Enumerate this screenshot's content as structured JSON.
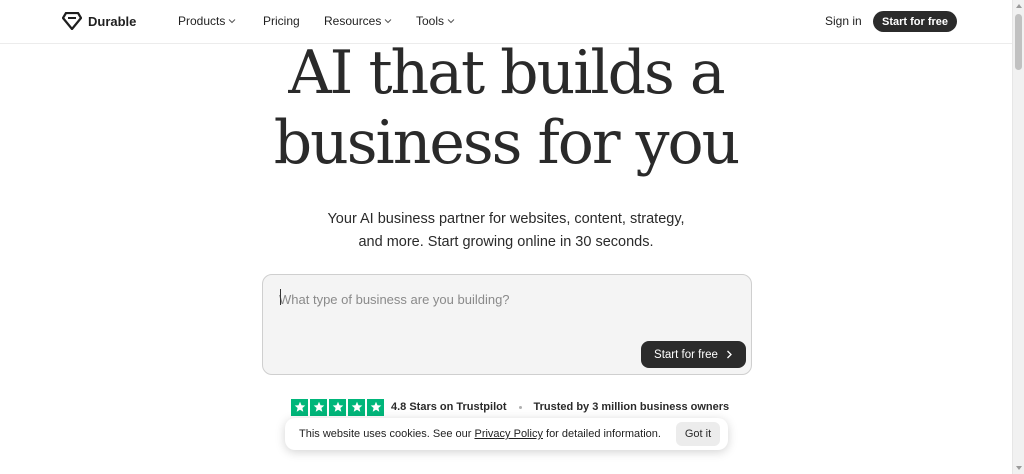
{
  "header": {
    "brand": "Durable",
    "nav": {
      "products": "Products",
      "pricing": "Pricing",
      "resources": "Resources",
      "tools": "Tools"
    },
    "sign_in": "Sign in",
    "cta": "Start for free"
  },
  "hero": {
    "title_line1": "AI that builds a",
    "title_line2": "business for you",
    "subtitle_line1": "Your AI business partner for websites, content, strategy,",
    "subtitle_line2": "and more. Start growing online in 30 seconds."
  },
  "prompt": {
    "placeholder": "What type of business are you building?",
    "value": "",
    "cta": "Start for free"
  },
  "trust": {
    "rating_text": "4.8 Stars on Trustpilot",
    "star_count": 5,
    "trusted_text": "Trusted by 3 million business owners"
  },
  "cookie": {
    "text_before": "This website uses cookies. See our ",
    "link": "Privacy Policy",
    "text_after": " for detailed information.",
    "button": "Got it"
  },
  "colors": {
    "trustpilot_green": "#00b67a",
    "button_dark": "#2b2b2b"
  }
}
